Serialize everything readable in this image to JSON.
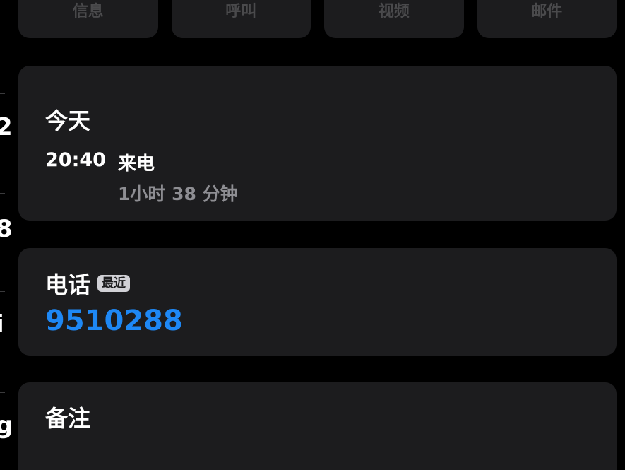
{
  "actions": [
    {
      "label": "信息"
    },
    {
      "label": "呼叫"
    },
    {
      "label": "视频"
    },
    {
      "label": "邮件"
    }
  ],
  "recent": {
    "title": "今天",
    "call_time": "20:40",
    "call_type": "来电",
    "call_duration": "1小时 38 分钟"
  },
  "phone": {
    "label": "电话",
    "badge": "最近",
    "number": "9510288"
  },
  "notes": {
    "title": "备注"
  },
  "edge_glyphs": [
    "2",
    "8",
    "i",
    "g"
  ],
  "colors": {
    "background": "#000000",
    "card": "#1c1c1e",
    "link": "#1e88f5",
    "secondary_text": "#8e8e93"
  }
}
